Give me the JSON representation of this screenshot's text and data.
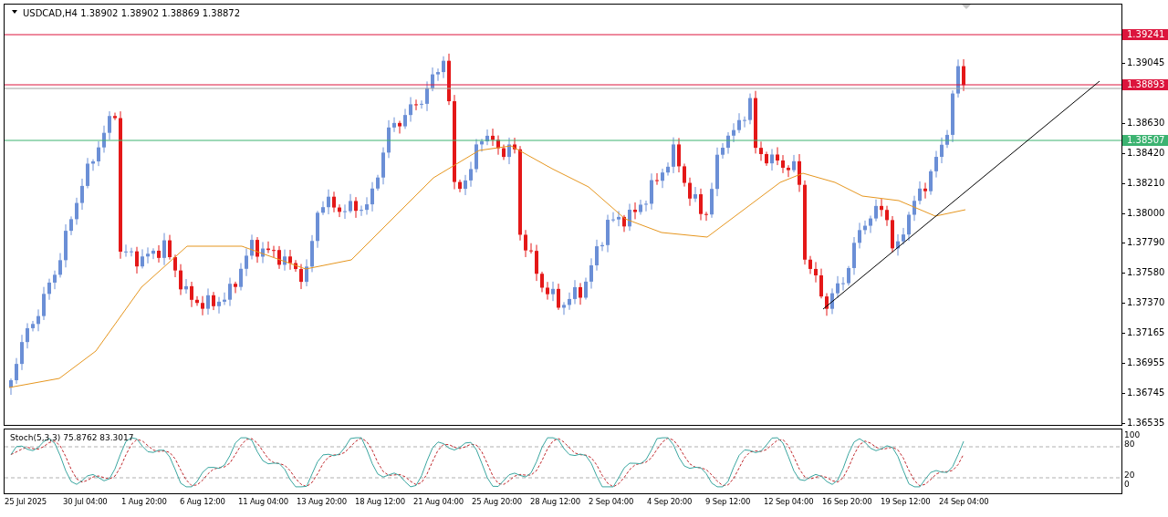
{
  "chart": {
    "symbol_header": "USDCAD,H4  1.38902 1.38902 1.38869 1.38872",
    "price_ticks": [
      "1.39045",
      "1.38630",
      "1.38420",
      "1.38210",
      "1.38000",
      "1.37790",
      "1.37580",
      "1.37370",
      "1.37165",
      "1.36955",
      "1.36745",
      "1.36535"
    ],
    "levels": [
      {
        "label": "1.39241",
        "color": "#dc143c"
      },
      {
        "label": "1.38893",
        "color": "#dc143c"
      },
      {
        "label": "1.38507",
        "color": "#3cb371"
      }
    ]
  },
  "stochastic": {
    "header": "Stoch(5,3,3) 75.8762 83.3017",
    "ticks": [
      "100",
      "80",
      "20",
      "0"
    ]
  },
  "time_axis": [
    "25 Jul 2025",
    "30 Jul 04:00",
    "1 Aug 20:00",
    "6 Aug 12:00",
    "11 Aug 04:00",
    "13 Aug 20:00",
    "18 Aug 12:00",
    "21 Aug 04:00",
    "25 Aug 20:00",
    "28 Aug 12:00",
    "2 Sep 04:00",
    "4 Sep 20:00",
    "9 Sep 12:00",
    "12 Sep 04:00",
    "16 Sep 20:00",
    "19 Sep 12:00",
    "24 Sep 04:00"
  ]
}
